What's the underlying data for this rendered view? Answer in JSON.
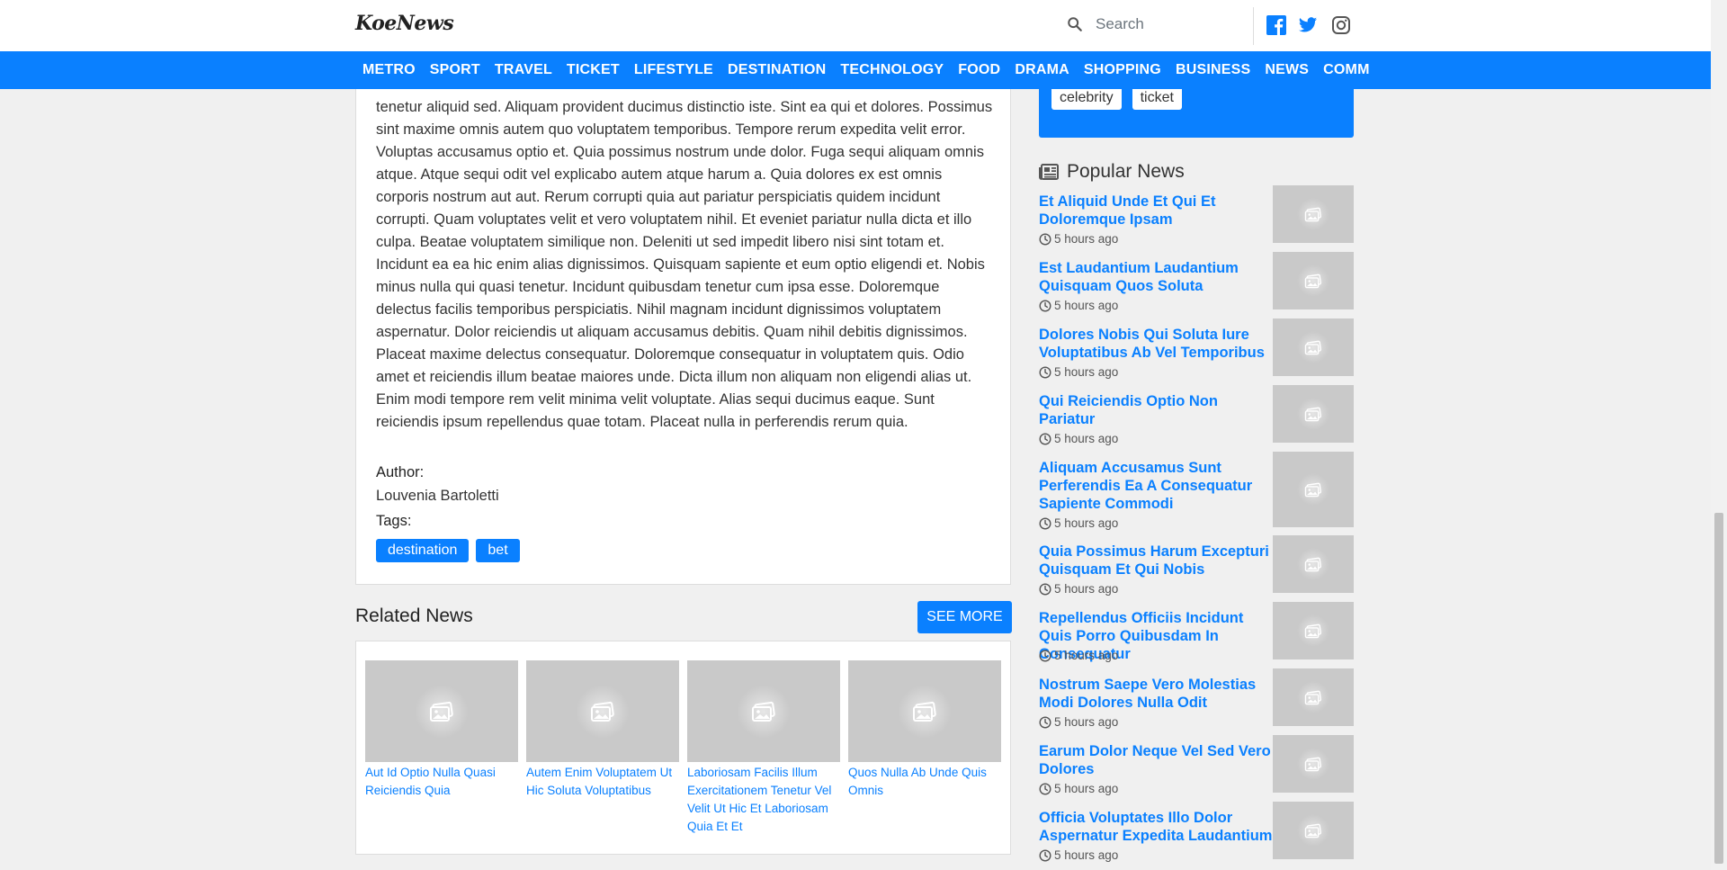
{
  "header": {
    "logo": "KoeNews",
    "search_placeholder": "Search",
    "social": [
      "facebook-icon",
      "twitter-icon",
      "instagram-icon"
    ]
  },
  "nav": {
    "items": [
      "Metro",
      "Sport",
      "Travel",
      "Ticket",
      "Lifestyle",
      "Destination",
      "Technology",
      "Food",
      "Drama",
      "Shopping",
      "Business",
      "News",
      "Community"
    ]
  },
  "article": {
    "body": "tenetur aliquid sed. Aliquam provident ducimus distinctio iste. Sint ea qui et dolores. Possimus sint maxime omnis autem quo voluptatem temporibus. Tempore rerum expedita velit error. Voluptas accusamus optio et. Quia possimus nostrum unde dolor. Fuga sequi aliquam omnis atque. Atque sequi odit vel explicabo autem atque harum a. Quia dolores ex est omnis corporis nostrum aut aut. Rerum corrupti quia aut pariatur perspiciatis quidem incidunt corrupti. Quam voluptates velit et vero voluptatem nihil. Et eveniet pariatur nulla dicta et illo culpa. Beatae voluptatem similique non. Deleniti ut sed impedit libero nisi sint totam et. Incidunt ea ea hic enim alias dignissimos. Quisquam sapiente et eum optio eligendi et. Nobis minus nulla qui quasi tenetur. Incidunt quibusdam tenetur cum ipsa esse. Doloremque delectus facilis temporibus perspiciatis. Nihil magnam incidunt dignissimos voluptatem aspernatur. Dolor reiciendis ut aliquam accusamus debitis. Quam nihil debitis dignissimos. Placeat maxime delectus consequatur. Doloremque consequatur in voluptatem quis. Odio amet et reiciendis illum beatae maiores unde. Dicta illum non aliquam non eligendi alias ut. Enim modi tempore rem velit minima velit voluptate. Alias sequi ducimus eaque. Sunt reiciendis ipsum repellendus quae totam. Placeat nulla in perferendis rerum quia.",
    "author_label": "Author:",
    "author_name": "Louvenia Bartoletti",
    "tags_label": "Tags:",
    "tags": [
      "destination",
      "bet"
    ]
  },
  "related": {
    "title": "Related News",
    "see_more": "SEE MORE",
    "items": [
      "Aut Id Optio Nulla Quasi Reiciendis Quia",
      "Autem Enim Voluptatem Ut Hic Soluta Voluptatibus",
      "Laboriosam Facilis Illum Exercitationem Tenetur Vel Velit Ut Hic Et Laboriosam Quia Et Et",
      "Quos Nulla Ab Unde Quis Omnis"
    ]
  },
  "sidebar": {
    "tags": [
      "celebrity",
      "ticket"
    ],
    "popular_title": "Popular News",
    "popular": [
      {
        "title": "Et Aliquid Unde Et Qui Et Doloremque Ipsam",
        "time": "5 hours ago"
      },
      {
        "title": "Est Laudantium Laudantium Quisquam Quos Soluta",
        "time": "5 hours ago"
      },
      {
        "title": "Dolores Nobis Qui Soluta Iure Voluptatibus Ab Vel Temporibus",
        "time": "5 hours ago"
      },
      {
        "title": "Qui Reiciendis Optio Non Pariatur",
        "time": "5 hours ago"
      },
      {
        "title": "Aliquam Accusamus Sunt Perferendis Ea A Consequatur Sapiente Commodi",
        "time": "5 hours ago"
      },
      {
        "title": "Quia Possimus Harum Excepturi Quisquam Et Qui Nobis",
        "time": "5 hours ago"
      },
      {
        "title": "Repellendus Officiis Incidunt Quis Porro Quibusdam In Consequatur",
        "time": "5 hours ago"
      },
      {
        "title": "Nostrum Saepe Vero Molestias Modi Dolores Nulla Odit",
        "time": "5 hours ago"
      },
      {
        "title": "Earum Dolor Neque Vel Sed Vero Dolores",
        "time": "5 hours ago"
      },
      {
        "title": "Officia Voluptates Illo Dolor Aspernatur Expedita Laudantium",
        "time": "5 hours ago"
      }
    ]
  },
  "colors": {
    "accent": "#0a80ff",
    "placeholder": "#c9c9c9",
    "background": "#f0f0f0"
  }
}
